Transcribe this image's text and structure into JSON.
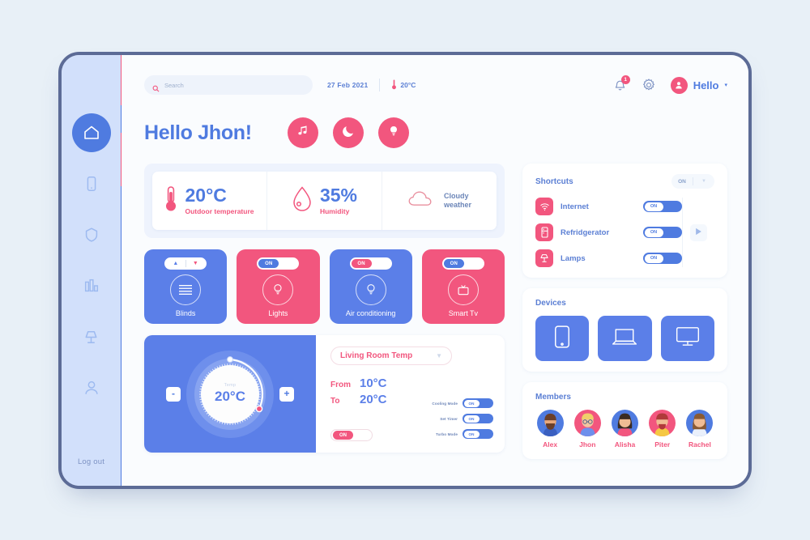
{
  "colors": {
    "blue": "#5b7fe8",
    "blue_dark": "#4f7be0",
    "pink": "#f2567e",
    "bg": "#e8f0f7",
    "rail": "#d2e0fb",
    "frame_border": "#5c6b96"
  },
  "sidebar": {
    "items": [
      {
        "icon": "home-icon",
        "name": "sidebar-item-home",
        "active": true
      },
      {
        "icon": "mobile-icon",
        "name": "sidebar-item-devices",
        "active": false
      },
      {
        "icon": "shield-icon",
        "name": "sidebar-item-security",
        "active": false
      },
      {
        "icon": "bar-chart-icon",
        "name": "sidebar-item-statistics",
        "active": false
      },
      {
        "icon": "lamp-icon",
        "name": "sidebar-item-lighting",
        "active": false
      },
      {
        "icon": "user-icon",
        "name": "sidebar-item-profile",
        "active": false
      }
    ],
    "logout_label": "Log out"
  },
  "topbar": {
    "search_placeholder": "Search",
    "search_value": "",
    "search_icon": "search-icon",
    "date": "27 Feb 2021",
    "temperature": "20°C",
    "temperature_icon": "thermometer-icon",
    "notification_icon": "bell-icon",
    "notification_count": "1",
    "settings_icon": "gear-icon",
    "user_avatar_icon": "user-avatar-icon",
    "user_label": "Hello",
    "user_chevron": "▾"
  },
  "greeting": {
    "title": "Hello Jhon!",
    "quick_actions": [
      {
        "label": "Music",
        "icon": "music-note-icon"
      },
      {
        "label": "Night mode",
        "icon": "moon-icon"
      },
      {
        "label": "Lights",
        "icon": "lightbulb-icon"
      }
    ]
  },
  "stats": [
    {
      "icon": "thermometer-icon",
      "value": "20°C",
      "label": "Outdoor temperature"
    },
    {
      "icon": "water-drop-icon",
      "value": "35%",
      "label": "Humidity"
    },
    {
      "icon": "cloud-icon",
      "line1": "Cloudy",
      "line2": "weather"
    }
  ],
  "tiles": [
    {
      "name": "Blinds",
      "color": "blue",
      "icon": "blinds-icon",
      "control": "updown",
      "up": "▲",
      "down": "▼"
    },
    {
      "name": "Lights",
      "color": "pink",
      "icon": "lightbulb-outline-icon",
      "control": "switch",
      "state": "ON",
      "knob": "blue"
    },
    {
      "name": "Air conditioning",
      "color": "blue",
      "icon": "lightbulb-outline-icon",
      "control": "switch",
      "state": "ON",
      "knob": "pink"
    },
    {
      "name": "Smart Tv",
      "color": "pink",
      "icon": "tv-icon",
      "control": "switch",
      "state": "ON",
      "knob": "blue"
    }
  ],
  "thermostat": {
    "dial_caption": "Temp",
    "dial_value": "20°C",
    "minus_label": "-",
    "plus_label": "+",
    "room": "Living Room Temp",
    "room_chevron": "▼",
    "from_label": "From",
    "from_value": "10°C",
    "to_label": "To",
    "to_value": "20°C",
    "power_state": "ON",
    "modes": [
      {
        "label": "Cooling Mode",
        "state": "ON"
      },
      {
        "label": "Set Timer",
        "state": "ON"
      },
      {
        "label": "Turbo Mode",
        "state": "ON"
      }
    ]
  },
  "shortcuts": {
    "title": "Shortcuts",
    "master_state": "ON",
    "master_chevron": "▼",
    "play_icon": "play-icon",
    "items": [
      {
        "name": "Internet",
        "icon": "wifi-icon",
        "state": "ON"
      },
      {
        "name": "Refridgerator",
        "icon": "fridge-icon",
        "state": "ON"
      },
      {
        "name": "Lamps",
        "icon": "lamp-icon",
        "state": "ON"
      }
    ]
  },
  "devices": {
    "title": "Devices",
    "items": [
      {
        "name": "tablet",
        "icon": "tablet-icon"
      },
      {
        "name": "laptop",
        "icon": "laptop-icon"
      },
      {
        "name": "monitor",
        "icon": "monitor-icon"
      }
    ]
  },
  "members": {
    "title": "Members",
    "items": [
      {
        "name": "Alex",
        "bg": "#4f7be0",
        "skin": "#e8a87c",
        "hair": "#6b3f2a",
        "shirt": "#3a5fc0"
      },
      {
        "name": "Jhon",
        "bg": "#f2567e",
        "skin": "#f3c6a0",
        "hair": "#f0cf6a",
        "shirt": "#6e8fec"
      },
      {
        "name": "Alisha",
        "bg": "#4f7be0",
        "skin": "#f0bc94",
        "hair": "#3a2b22",
        "shirt": "#f2567e"
      },
      {
        "name": "Piter",
        "bg": "#f2567e",
        "skin": "#f0bc94",
        "hair": "#b03a3a",
        "shirt": "#f5c843"
      },
      {
        "name": "Rachel",
        "bg": "#4f7be0",
        "skin": "#f0bc94",
        "hair": "#8a5a34",
        "shirt": "#eaf0fb"
      }
    ]
  }
}
